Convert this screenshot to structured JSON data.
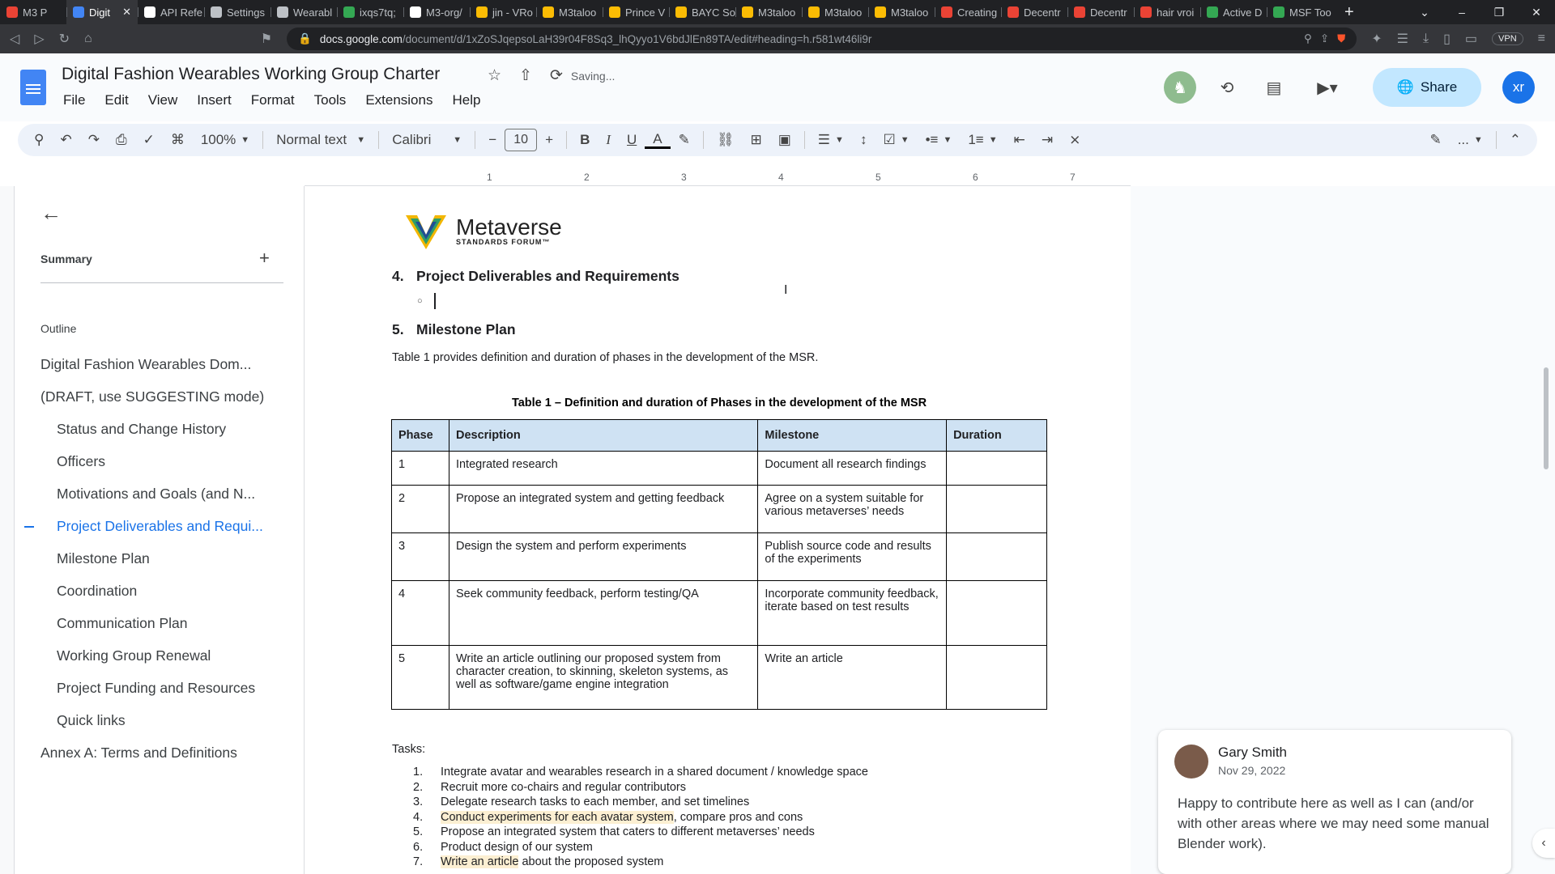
{
  "browser": {
    "tabs": [
      {
        "label": "M3 P",
        "color": "#ea4335"
      },
      {
        "label": "Digit",
        "color": "#4285f4",
        "active": true
      },
      {
        "label": "API Refe",
        "color": "#ffffff"
      },
      {
        "label": "Settings",
        "color": "#bdc1c6"
      },
      {
        "label": "Wearabl",
        "color": "#bdc1c6"
      },
      {
        "label": "ixqs7tq;",
        "color": "#34a853"
      },
      {
        "label": "M3-org/",
        "color": "#ffffff"
      },
      {
        "label": "jin - VRo",
        "color": "#fbbc04"
      },
      {
        "label": "M3taloo",
        "color": "#fbbc04"
      },
      {
        "label": "Prince V",
        "color": "#fbbc04"
      },
      {
        "label": "BAYC So",
        "color": "#fbbc04"
      },
      {
        "label": "M3taloo",
        "color": "#fbbc04"
      },
      {
        "label": "M3taloo",
        "color": "#fbbc04"
      },
      {
        "label": "M3taloo",
        "color": "#fbbc04"
      },
      {
        "label": "Creating",
        "color": "#ea4335"
      },
      {
        "label": "Decentr",
        "color": "#ea4335"
      },
      {
        "label": "Decentr",
        "color": "#ea4335"
      },
      {
        "label": "hair vroi",
        "color": "#ea4335"
      },
      {
        "label": "Active D",
        "color": "#34a853"
      },
      {
        "label": "MSF Too",
        "color": "#34a853"
      }
    ],
    "url_domain": "docs.google.com",
    "url_path": "/document/d/1xZoSJqepsoLaH39r04F8Sq3_lhQyyo1V6bdJlEn89TA/edit#heading=h.r581wt46li9r",
    "vpn": "VPN"
  },
  "doc": {
    "title": "Digital Fashion Wearables Working Group Charter",
    "saving": "Saving...",
    "menus": [
      "File",
      "Edit",
      "View",
      "Insert",
      "Format",
      "Tools",
      "Extensions",
      "Help"
    ],
    "share": "Share",
    "avatar_initials": "xr"
  },
  "toolbar": {
    "zoom": "100%",
    "style": "Normal text",
    "font": "Calibri",
    "font_size": "10",
    "more": "..."
  },
  "ruler": [
    "1",
    "2",
    "3",
    "4",
    "5",
    "6",
    "7"
  ],
  "sidebar": {
    "summary": "Summary",
    "outline": "Outline",
    "items": [
      {
        "label": "Digital Fashion Wearables Dom...",
        "level": 1
      },
      {
        "label": "(DRAFT, use SUGGESTING mode)",
        "level": 1
      },
      {
        "label": "Status and Change History",
        "level": 2
      },
      {
        "label": "Officers",
        "level": 2
      },
      {
        "label": "Motivations and Goals (and N...",
        "level": 2
      },
      {
        "label": "Project Deliverables and Requi...",
        "level": 2,
        "active": true
      },
      {
        "label": "Milestone Plan",
        "level": 2
      },
      {
        "label": "Coordination",
        "level": 2
      },
      {
        "label": "Communication Plan",
        "level": 2
      },
      {
        "label": "Working Group Renewal",
        "level": 2
      },
      {
        "label": "Project Funding and Resources",
        "level": 2
      },
      {
        "label": "Quick links",
        "level": 2
      },
      {
        "label": "Annex A: Terms and Definitions",
        "level": 1
      }
    ]
  },
  "content": {
    "logo_line1": "Metaverse",
    "logo_line2": "STANDARDS FORUM™",
    "h4_num": "4.",
    "h4": "Project Deliverables and Requirements",
    "h5_num": "5.",
    "h5": "Milestone Plan",
    "para": "Table 1 provides definition and duration of phases in the development of the MSR.",
    "table_caption": "Table 1 – Definition and duration of Phases in the development of the MSR",
    "table_headers": [
      "Phase",
      "Description",
      "Milestone",
      "Duration"
    ],
    "table_rows": [
      [
        "1",
        "Integrated research",
        "Document all research findings",
        ""
      ],
      [
        "2",
        "Propose an integrated system and getting feedback",
        "Agree on a system suitable for various metaverses’ needs",
        ""
      ],
      [
        "3",
        "Design the system and perform experiments",
        "Publish source code and results of the experiments",
        ""
      ],
      [
        "4",
        "Seek community feedback, perform testing/QA",
        "Incorporate community feedback, iterate based on test results",
        ""
      ],
      [
        "5",
        "Write an article outlining our proposed system from character creation, to skinning, skeleton systems, as well as software/game engine integration",
        "Write an article",
        ""
      ]
    ],
    "tasks_label": "Tasks:",
    "tasks": [
      {
        "n": "1.",
        "pre": "",
        "hl": "",
        "post": "Integrate avatar and wearables research in a shared document / knowledge space"
      },
      {
        "n": "2.",
        "pre": "",
        "hl": "",
        "post": "Recruit more co-chairs and regular contributors"
      },
      {
        "n": "3.",
        "pre": "",
        "hl": "",
        "post": "Delegate research tasks to each member, and set timelines"
      },
      {
        "n": "4.",
        "pre": "",
        "hl": "Conduct experiments for each avatar system",
        "post": ", compare pros and cons"
      },
      {
        "n": "5.",
        "pre": "",
        "hl": "",
        "post": "Propose an integrated system that caters to different metaverses’ needs"
      },
      {
        "n": "6.",
        "pre": "",
        "hl": "",
        "post": "Product design of our system"
      },
      {
        "n": "7.",
        "pre": "",
        "hl": "Write an article",
        "post": " about the proposed system"
      }
    ]
  },
  "comment": {
    "author": "Gary Smith",
    "date": "Nov 29, 2022",
    "text": "Happy to contribute here as well as I can (and/or with other areas where we may need some manual Blender work)."
  }
}
